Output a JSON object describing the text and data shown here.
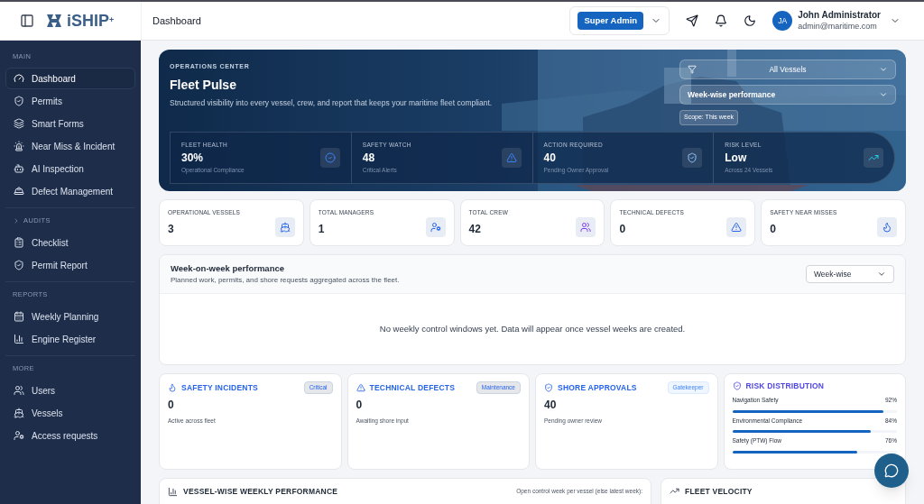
{
  "topbar": {
    "logo": "iSHIP",
    "logo_mark": "+",
    "page_title": "Dashboard",
    "role": "Super Admin",
    "user": {
      "initials": "JA",
      "name": "John Administrator",
      "email": "admin@maritime.com"
    }
  },
  "sidebar": {
    "sections": [
      {
        "title": "MAIN",
        "collapsible": false,
        "items": [
          {
            "label": "Dashboard",
            "selected": true
          },
          {
            "label": "Permits",
            "selected": false
          },
          {
            "label": "Smart Forms",
            "selected": false
          },
          {
            "label": "Near Miss & Incident",
            "selected": false
          },
          {
            "label": "AI Inspection",
            "selected": false
          },
          {
            "label": "Defect Management",
            "selected": false
          }
        ]
      },
      {
        "title": "AUDITS",
        "collapsible": true,
        "items": [
          {
            "label": "Checklist",
            "selected": false
          },
          {
            "label": "Permit Report",
            "selected": false
          }
        ]
      },
      {
        "title": "REPORTS",
        "collapsible": false,
        "items": [
          {
            "label": "Weekly Planning",
            "selected": false
          },
          {
            "label": "Engine Register",
            "selected": false
          }
        ]
      },
      {
        "title": "MORE",
        "collapsible": false,
        "items": [
          {
            "label": "Users",
            "selected": false
          },
          {
            "label": "Vessels",
            "selected": false
          },
          {
            "label": "Access requests",
            "selected": false
          }
        ]
      }
    ]
  },
  "hero": {
    "eyebrow": "OPERATIONS CENTER",
    "title": "Fleet Pulse",
    "subtitle": "Structured visibility into every vessel, crew, and report that keeps your maritime fleet compliant.",
    "vessel_filter": "All Vessels",
    "view_select": "Week-wise performance",
    "scope": "Scope: This week",
    "metrics": [
      {
        "label": "FLEET HEALTH",
        "value": "30%",
        "note": "Operational Compliance"
      },
      {
        "label": "SAFETY WATCH",
        "value": "48",
        "note": "Critical Alerts"
      },
      {
        "label": "ACTION REQUIRED",
        "value": "40",
        "note": "Pending Owner Approval"
      },
      {
        "label": "RISK LEVEL",
        "value": "Low",
        "note": "Across 24 Vessels"
      }
    ]
  },
  "stats": [
    {
      "label": "OPERATIONAL VESSELS",
      "value": "3"
    },
    {
      "label": "TOTAL MANAGERS",
      "value": "1"
    },
    {
      "label": "TOTAL CREW",
      "value": "42"
    },
    {
      "label": "TECHNICAL DEFECTS",
      "value": "0"
    },
    {
      "label": "SAFETY NEAR MISSES",
      "value": "0"
    }
  ],
  "weekly": {
    "title": "Week-on-week performance",
    "subtitle": "Planned work, permits, and shore requests aggregated across the fleet.",
    "select": "Week-wise",
    "empty": "No weekly control windows yet. Data will appear once vessel weeks are created."
  },
  "cards": [
    {
      "title": "SAFETY INCIDENTS",
      "tag": "Critical",
      "value": "0",
      "note": "Active across fleet"
    },
    {
      "title": "TECHNICAL DEFECTS",
      "tag": "Maintenance",
      "value": "0",
      "note": "Awaiting shore input"
    },
    {
      "title": "SHORE APPROVALS",
      "tag": "Gatekeeper",
      "value": "40",
      "note": "Pending owner review"
    }
  ],
  "risk": {
    "title": "RISK DISTRIBUTION",
    "items": [
      {
        "label": "Navigation Safety",
        "value": "92%",
        "level": 0.92
      },
      {
        "label": "Environmental Compliance",
        "value": "84%",
        "level": 0.84
      },
      {
        "label": "Safety (PTW) Flow",
        "value": "76%",
        "level": 0.76
      }
    ]
  },
  "vessel_perf": {
    "title": "VESSEL-WISE WEEKLY PERFORMANCE",
    "note": "Open control week per vessel (else latest week):"
  },
  "velocity": {
    "title": "FLEET VELOCITY"
  }
}
